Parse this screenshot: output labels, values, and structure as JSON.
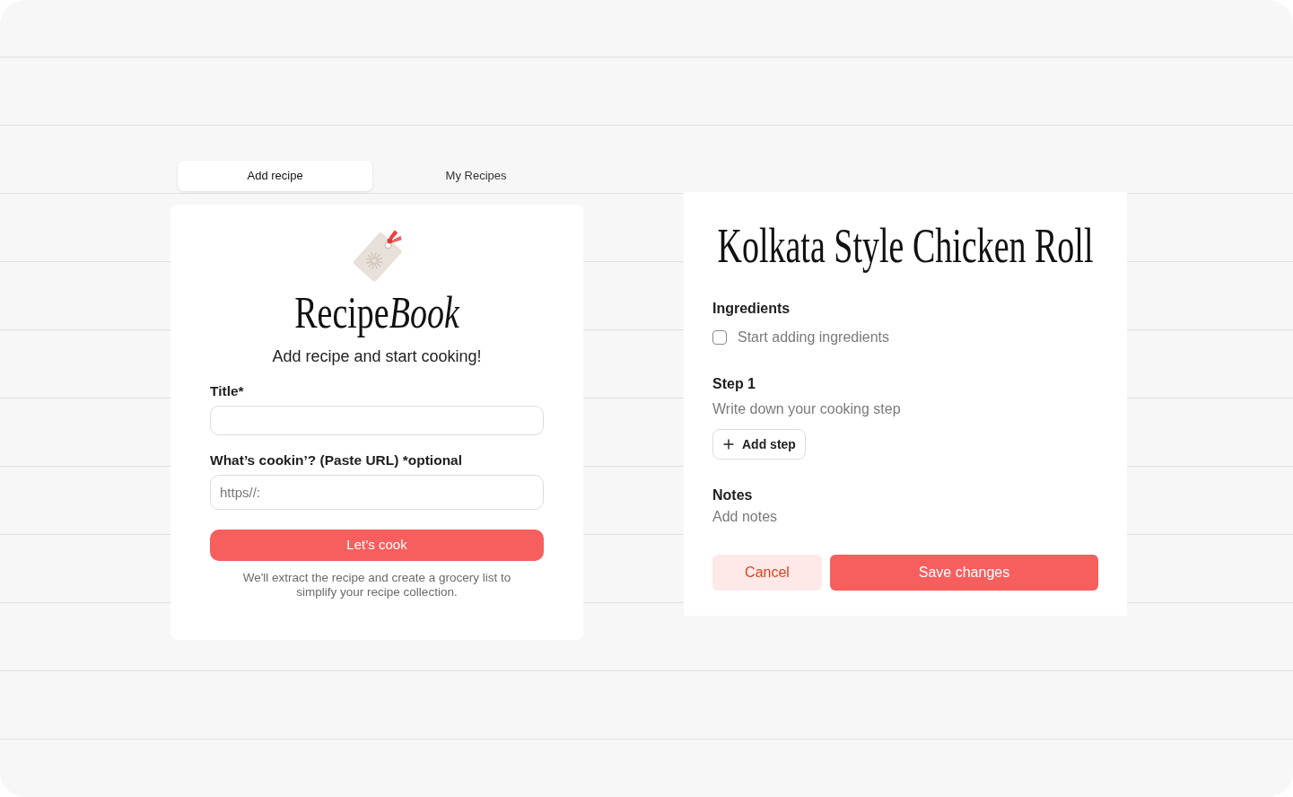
{
  "tabs": [
    {
      "label": "Add recipe",
      "selected": true
    },
    {
      "label": "My Recipes",
      "selected": false
    }
  ],
  "add_recipe": {
    "logo": [
      {
        "text": "Recipe",
        "italic": false
      },
      {
        "text": "Book",
        "italic": true
      }
    ],
    "tagline": "Add recipe and start cooking!",
    "fields": [
      {
        "label": "Title*"
      },
      {
        "label": "What’s cookin’? (Paste URL) *optional",
        "placeholder": "https//:"
      }
    ],
    "submit_button": "Let’s cook",
    "note": "We'll extract the recipe and create a grocery list to simplify your recipe collection."
  },
  "recipe": {
    "title": "Kolkata Style Chicken Roll",
    "ingredients": {
      "heading": "Ingredients",
      "items": [
        {
          "placeholder": "Start adding ingredients",
          "checked": false
        }
      ]
    },
    "steps": [
      {
        "heading": "Step 1",
        "placeholder": "Write down your cooking step"
      }
    ],
    "add_step_button": "Add step",
    "notes": {
      "heading": "Notes",
      "placeholder": "Add notes"
    },
    "buttons": [
      {
        "label": "Cancel",
        "kind": "secondary"
      },
      {
        "label": "Save changes",
        "kind": "primary"
      }
    ]
  }
}
